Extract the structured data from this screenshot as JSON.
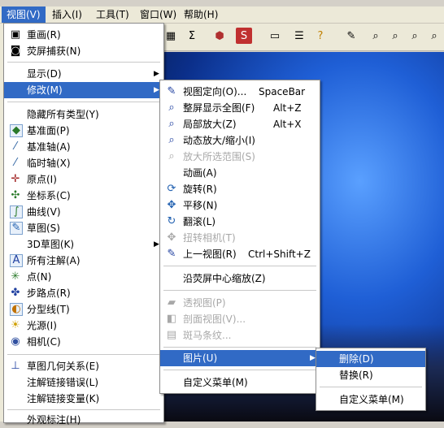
{
  "menubar": [
    {
      "label": "视图(V)"
    },
    {
      "label": "插入(I)"
    },
    {
      "label": "工具(T)"
    },
    {
      "label": "窗口(W)"
    },
    {
      "label": "帮助(H)"
    }
  ],
  "view_menu": {
    "items": [
      {
        "label": "重画(R)",
        "icon": "redraw-icon"
      },
      {
        "label": "荧屏捕获(N)",
        "icon": "camera-icon"
      },
      {
        "label": "显示(D)",
        "submenu": true
      },
      {
        "label": "修改(M)",
        "submenu": true,
        "highlighted": true
      },
      {
        "label": "隐藏所有类型(Y)"
      },
      {
        "label": "基准面(P)",
        "icon": "plane-icon"
      },
      {
        "label": "基准轴(A)",
        "icon": "axis-icon"
      },
      {
        "label": "临时轴(X)",
        "icon": "temp-axis-icon"
      },
      {
        "label": "原点(I)",
        "icon": "origin-icon"
      },
      {
        "label": "坐标系(C)",
        "icon": "coordinate-system-icon"
      },
      {
        "label": "曲线(V)",
        "icon": "curve-icon"
      },
      {
        "label": "草图(S)",
        "icon": "sketch-icon"
      },
      {
        "label": "3D草图(K)",
        "submenu": true
      },
      {
        "label": "所有注解(A)",
        "icon": "annotation-icon"
      },
      {
        "label": "点(N)",
        "icon": "point-icon"
      },
      {
        "label": "步路点(R)",
        "icon": "route-point-icon"
      },
      {
        "label": "分型线(T)",
        "icon": "parting-line-icon"
      },
      {
        "label": "光源(I)",
        "icon": "light-icon"
      },
      {
        "label": "相机(C)",
        "icon": "camera-icon"
      },
      {
        "label": "草图几何关系(E)",
        "icon": "sketch-relations-icon"
      },
      {
        "label": "注解链接错误(L)"
      },
      {
        "label": "注解链接变量(K)"
      },
      {
        "label": "外观标注(H)"
      }
    ]
  },
  "modify_menu": {
    "items": [
      {
        "label": "视图定向(O)...",
        "accel": "SpaceBar",
        "icon": "view-orientation-icon"
      },
      {
        "label": "整屏显示全图(F)",
        "accel": "Alt+Z",
        "icon": "zoom-fit-icon"
      },
      {
        "label": "局部放大(Z)",
        "accel": "Alt+X",
        "icon": "zoom-area-icon"
      },
      {
        "label": "动态放大/缩小(I)",
        "icon": "zoom-dynamic-icon"
      },
      {
        "label": "放大所选范围(S)",
        "icon": "zoom-selection-icon",
        "disabled": true
      },
      {
        "label": "动画(A)"
      },
      {
        "label": "旋转(R)",
        "icon": "rotate-icon"
      },
      {
        "label": "平移(N)",
        "icon": "pan-icon"
      },
      {
        "label": "翻滚(L)",
        "icon": "roll-icon"
      },
      {
        "label": "扭转相机(T)",
        "icon": "turn-camera-icon",
        "disabled": true
      },
      {
        "label": "上一视图(R)",
        "accel": "Ctrl+Shift+Z",
        "icon": "previous-view-icon"
      },
      {
        "label": "沿荧屏中心缩放(Z)"
      },
      {
        "label": "透视图(P)",
        "icon": "perspective-icon",
        "disabled": true
      },
      {
        "label": "剖面视图(V)...",
        "icon": "section-view-icon",
        "disabled": true
      },
      {
        "label": "斑马条纹...",
        "icon": "zebra-icon",
        "disabled": true
      },
      {
        "label": "图片(U)",
        "submenu": true,
        "highlighted": true
      },
      {
        "label": "自定义菜单(M)"
      }
    ]
  },
  "picture_menu": {
    "items": [
      {
        "label": "删除(D)",
        "highlighted": true
      },
      {
        "label": "替换(R)"
      },
      {
        "label": "自定义菜单(M)"
      }
    ]
  },
  "colors": {
    "highlight": "#316ac5",
    "menu_bg": "#ffffff",
    "disabled": "#a8a8a8"
  }
}
